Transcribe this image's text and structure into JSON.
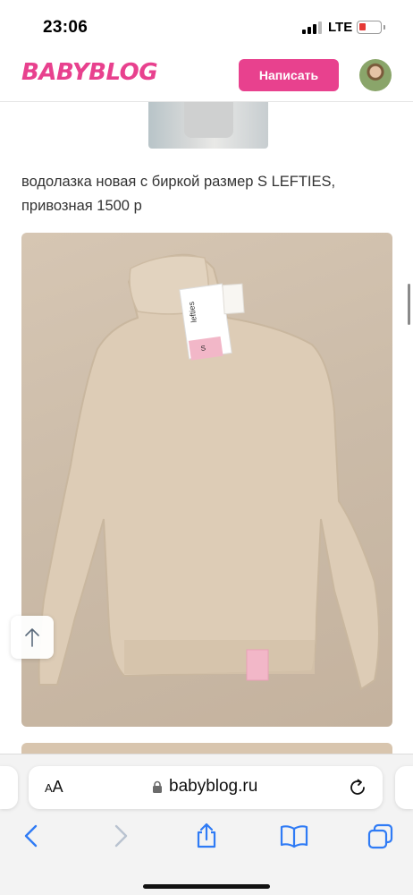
{
  "status_bar": {
    "time": "23:06",
    "network": "LTE",
    "signal_bars": 3,
    "battery_level": 0.2,
    "battery_color": "#e53935"
  },
  "header": {
    "logo_text": "BABYBLOG",
    "write_button_label": "Написать",
    "brand_color": "#e8418e"
  },
  "post": {
    "text": "водолазка новая с биркой размер S LEFTIES, привозная 1500 р"
  },
  "photo": {
    "tag_brand": "lefties",
    "tag_size": "S"
  },
  "browser": {
    "aa_label": "AA",
    "url": "babyblog.ru",
    "icons": [
      "lock-icon",
      "reload-icon",
      "back-icon",
      "forward-icon",
      "share-icon",
      "bookmarks-icon",
      "tabs-icon"
    ]
  }
}
